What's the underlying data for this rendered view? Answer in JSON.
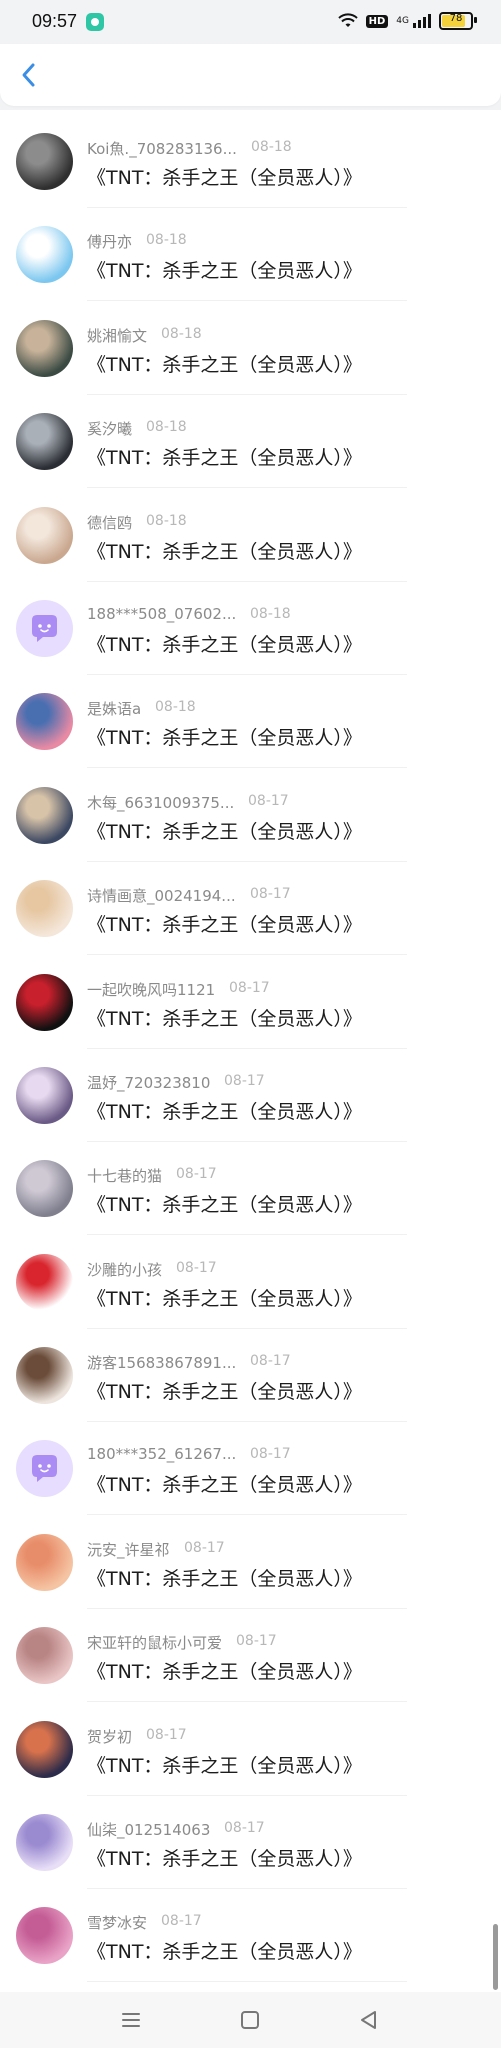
{
  "status": {
    "time": "09:57",
    "hd": "HD",
    "network": "4G",
    "battery_text": "78",
    "battery_level": 0.78
  },
  "header": {
    "back_icon": "chevron-left-icon",
    "accent": "#3a8ee6"
  },
  "items": [
    {
      "name": "Koi魚._708283136...",
      "date": "08-18",
      "comment": "《TNT：杀手之王（全员恶人）》",
      "avatar_colors": [
        "#2f2f2f",
        "#8c8c8c"
      ]
    },
    {
      "name": "傅丹亦",
      "date": "08-18",
      "comment": "《TNT：杀手之王（全员恶人）》",
      "avatar_colors": [
        "#7cc7ef",
        "#ffffff"
      ]
    },
    {
      "name": "姚湘愉文",
      "date": "08-18",
      "comment": "《TNT：杀手之王（全员恶人）》",
      "avatar_colors": [
        "#3b4b44",
        "#c8b39a"
      ]
    },
    {
      "name": "奚汐曦",
      "date": "08-18",
      "comment": "《TNT：杀手之王（全员恶人）》",
      "avatar_colors": [
        "#2a2d33",
        "#aab0b8"
      ]
    },
    {
      "name": "德信鸥",
      "date": "08-18",
      "comment": "《TNT：杀手之王（全员恶人）》",
      "avatar_colors": [
        "#caa890",
        "#f3e7dc"
      ]
    },
    {
      "name": "188***508_07602...",
      "date": "08-18",
      "comment": "《TNT：杀手之王（全员恶人）》",
      "avatar_colors": [
        "#e6ddff",
        "#ab8cf5"
      ],
      "default_avatar": true
    },
    {
      "name": "是姝语a",
      "date": "08-18",
      "comment": "《TNT：杀手之王（全员恶人）》",
      "avatar_colors": [
        "#e88aa4",
        "#4a6fb1"
      ]
    },
    {
      "name": "木每_6631009375...",
      "date": "08-17",
      "comment": "《TNT：杀手之王（全员恶人）》",
      "avatar_colors": [
        "#3c4862",
        "#d7c3a8"
      ]
    },
    {
      "name": "诗情画意_0024194...",
      "date": "08-17",
      "comment": "《TNT：杀手之王（全员恶人）》",
      "avatar_colors": [
        "#f4e6d9",
        "#e6c7a2"
      ]
    },
    {
      "name": "一起吹晚风吗1121",
      "date": "08-17",
      "comment": "《TNT：杀手之王（全员恶人）》",
      "avatar_colors": [
        "#111111",
        "#c8202c"
      ]
    },
    {
      "name": "温妤_720323810",
      "date": "08-17",
      "comment": "《TNT：杀手之王（全员恶人）》",
      "avatar_colors": [
        "#6a5a86",
        "#e7d9ef"
      ]
    },
    {
      "name": "十七巷的猫",
      "date": "08-17",
      "comment": "《TNT：杀手之王（全员恶人）》",
      "avatar_colors": [
        "#7f7f8e",
        "#cfc9d4"
      ]
    },
    {
      "name": "沙雕的小孩",
      "date": "08-17",
      "comment": "《TNT：杀手之王（全员恶人）》",
      "avatar_colors": [
        "#ffffff",
        "#d9262e"
      ]
    },
    {
      "name": "游客15683867891...",
      "date": "08-17",
      "comment": "《TNT：杀手之王（全员恶人）》",
      "avatar_colors": [
        "#ece4dd",
        "#6b4c3a"
      ]
    },
    {
      "name": "180***352_61267...",
      "date": "08-17",
      "comment": "《TNT：杀手之王（全员恶人）》",
      "avatar_colors": [
        "#e6ddff",
        "#ab8cf5"
      ],
      "default_avatar": true
    },
    {
      "name": "沅安_许星祁",
      "date": "08-17",
      "comment": "《TNT：杀手之王（全员恶人）》",
      "avatar_colors": [
        "#f5c4a3",
        "#e88d6a"
      ]
    },
    {
      "name": "宋亚轩的鼠标小可爱",
      "date": "08-17",
      "comment": "《TNT：杀手之王（全员恶人）》",
      "avatar_colors": [
        "#e9c5c5",
        "#b98484"
      ]
    },
    {
      "name": "贺岁初",
      "date": "08-17",
      "comment": "《TNT：杀手之王（全员恶人）》",
      "avatar_colors": [
        "#2c2b49",
        "#d8724d"
      ]
    },
    {
      "name": "仙柒_012514063",
      "date": "08-17",
      "comment": "《TNT：杀手之王（全员恶人）》",
      "avatar_colors": [
        "#e8dff7",
        "#9a8ad0"
      ]
    },
    {
      "name": "雪梦冰安",
      "date": "08-17",
      "comment": "《TNT：杀手之王（全员恶人）》",
      "avatar_colors": [
        "#e9a3c7",
        "#c45c95"
      ]
    }
  ],
  "navbar": {
    "menu_icon": "menu-icon",
    "home_icon": "home-square-icon",
    "back_icon": "triangle-back-icon"
  }
}
